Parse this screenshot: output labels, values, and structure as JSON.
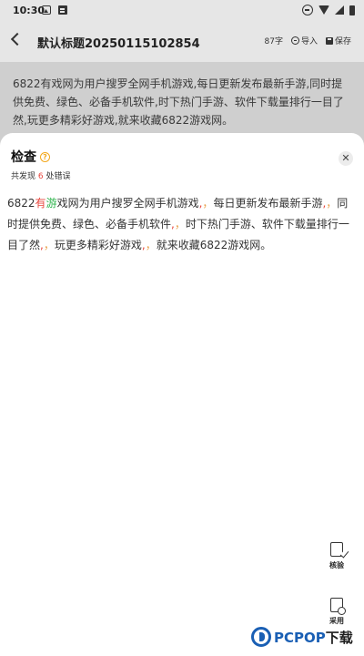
{
  "status_bar": {
    "time": "10:30"
  },
  "header": {
    "title": "默认标题20250115102854",
    "word_count": "87字",
    "import_label": "导入",
    "save_label": "保存"
  },
  "editor": {
    "text": "6822有戏网为用户搜罗全网手机游戏,每日更新发布最新手游,同时提供免费、绿色、必备手机软件,时下热门手游、软件下载量排行一目了然,玩更多精彩好游戏,就来收藏6822游戏网。"
  },
  "check_panel": {
    "title": "检查",
    "summary_prefix": "共发现",
    "error_count": "6",
    "summary_suffix": "处错误",
    "segments": [
      {
        "t": "6822",
        "c": ""
      },
      {
        "t": "有",
        "c": "hl"
      },
      {
        "t": "游",
        "c": "hl2"
      },
      {
        "t": "戏网为用户搜罗全网手机游戏",
        "c": ""
      },
      {
        "t": ",",
        "c": "hl"
      },
      {
        "t": "，",
        "c": "mark"
      },
      {
        "t": "每日更新发布最新手游",
        "c": ""
      },
      {
        "t": ",",
        "c": "hl"
      },
      {
        "t": "，",
        "c": "mark"
      },
      {
        "t": "同时提供免费、绿色、必备手机软件",
        "c": ""
      },
      {
        "t": ",",
        "c": "hl"
      },
      {
        "t": "，",
        "c": "mark"
      },
      {
        "t": "时下热门手游、软件下载量排行一目了然",
        "c": ""
      },
      {
        "t": ",",
        "c": "hl"
      },
      {
        "t": "，",
        "c": "mark"
      },
      {
        "t": "玩更多精彩好游戏",
        "c": ""
      },
      {
        "t": ",",
        "c": "hl"
      },
      {
        "t": "，",
        "c": "mark"
      },
      {
        "t": "就来收藏6822游戏网。",
        "c": ""
      }
    ]
  },
  "tools": {
    "verify_label": "核验",
    "adopt_label": "采用"
  },
  "watermark": {
    "brand_a": "PCPOP",
    "brand_b": "下载"
  },
  "colors": {
    "error": "#e8453c",
    "correct": "#2bb34a",
    "accent": "#f3a81c",
    "brand": "#1a5fb4"
  }
}
